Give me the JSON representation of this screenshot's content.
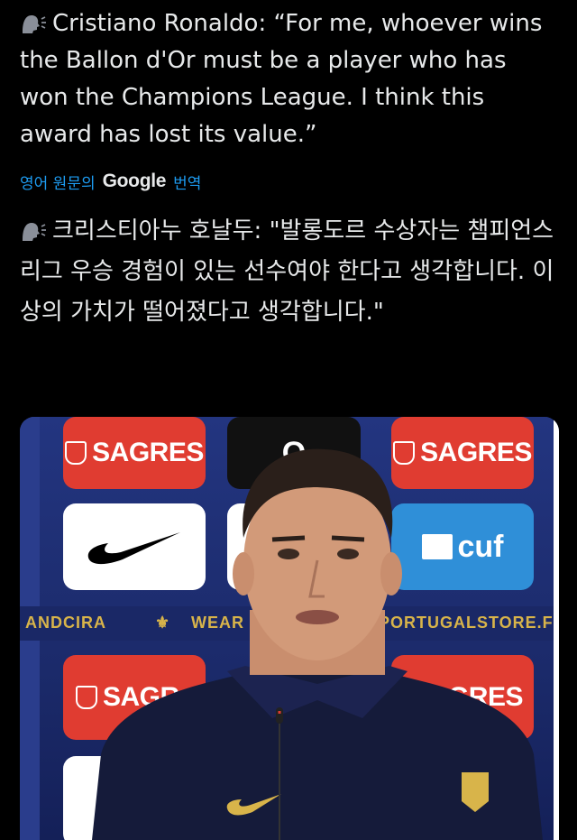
{
  "tweet": {
    "english_text": "Cristiano Ronaldo: “For me, whoever wins the Ballon d'Or must be a player who has won the Champions League. I think this award has lost its value.”",
    "translate_prefix": "영어 원문의",
    "translate_brand": "Google",
    "translate_suffix": "번역",
    "korean_text": "크리스티아누 호날두: \"발롱도르 수상자는 챔피언스리그 우승 경험이 있는 선수여야 한다고 생각합니다. 이 상의 가치가 떨어졌다고 생각합니다.\""
  },
  "media": {
    "sponsor_sagres": "SAGRES",
    "sponsor_cuf": "cuf",
    "band_left": "ANDCIRA",
    "band_mid": "WEAR",
    "band_right": "PORTUGALSTORE.FPF.I",
    "partial_sagres_left": "SAGR",
    "partial_sagres_right": "GRES",
    "partial_top": "O"
  },
  "icons": {
    "speaker": "speaking-head-icon"
  },
  "colors": {
    "background": "#000000",
    "text": "#e7e9ea",
    "link": "#1d9bf0",
    "sagres_red": "#e03c31",
    "backdrop_blue": "#1f2f6e"
  }
}
